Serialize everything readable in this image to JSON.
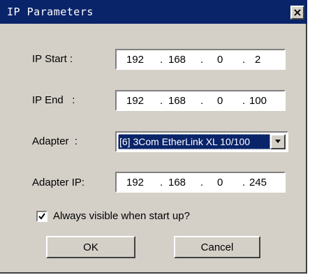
{
  "window": {
    "title": "IP Parameters",
    "close_glyph": "×"
  },
  "ip_start": {
    "label": "IP Start :",
    "octets": [
      "192",
      ".",
      "168",
      ".",
      "0",
      ".",
      "2"
    ]
  },
  "ip_end": {
    "label": "IP End   :",
    "octets": [
      "192",
      ".",
      "168",
      ".",
      "0",
      ".",
      "100"
    ]
  },
  "adapter": {
    "label": "Adapter  :",
    "selected": "[6] 3Com EtherLink XL 10/100"
  },
  "adapter_ip": {
    "label": "Adapter IP:",
    "octets": [
      "192",
      ".",
      "168",
      ".",
      "0",
      ".",
      "245"
    ]
  },
  "options": {
    "always_visible_label": "Always visible when start up?",
    "always_visible_checked": true
  },
  "buttons": {
    "ok": "OK",
    "cancel": "Cancel"
  },
  "colors": {
    "titlebar": "#0a246a",
    "face": "#d4d0c8",
    "highlight": "#0a246a"
  }
}
